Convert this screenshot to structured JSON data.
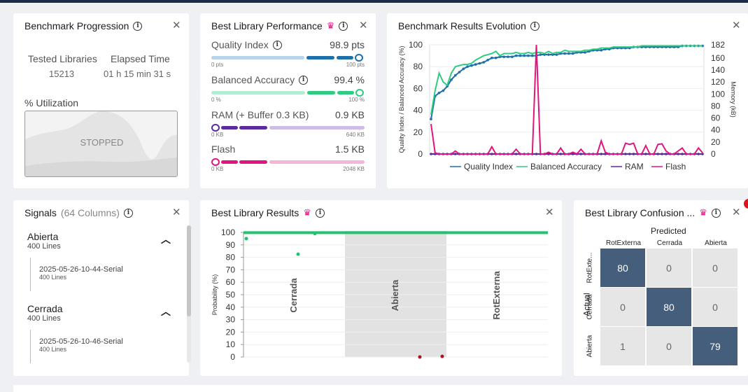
{
  "progression": {
    "title": "Benchmark Progression",
    "tested_label": "Tested Libraries",
    "tested_value": "15213",
    "elapsed_label": "Elapsed Time",
    "elapsed_value": "01 h 15 min 31 s",
    "util_label": "% Utilization",
    "util_status": "STOPPED"
  },
  "performance": {
    "title": "Best Library Performance",
    "metrics": [
      {
        "name": "Quality Index",
        "value": "98.9 pts",
        "min": "0 pts",
        "max": "100 pts",
        "fraction": 0.989,
        "color": "#1f6fa8",
        "light": "#b8d4e8",
        "has_info": true
      },
      {
        "name": "Balanced Accuracy",
        "value": "99.4 %",
        "min": "0 %",
        "max": "100 %",
        "fraction": 0.994,
        "color": "#2ecc80",
        "light": "#b4ecd2",
        "has_info": true
      },
      {
        "name": "RAM (+ Buffer 0.3 KB)",
        "value": "0.9 KB",
        "min": "0 KB",
        "max": "640 KB",
        "fraction": 0.0014,
        "color": "#5b2aa0",
        "light": "#cdbde6",
        "has_info": false
      },
      {
        "name": "Flash",
        "value": "1.5 KB",
        "min": "0 KB",
        "max": "2048 KB",
        "fraction": 0.0007,
        "color": "#e0157f",
        "light": "#f5b5d8",
        "has_info": false
      }
    ]
  },
  "evolution": {
    "title": "Benchmark Results Evolution",
    "y_left_label": "Quality Index / Balanced Accuracy (%)",
    "y_right_label": "Memory (kB)",
    "legend": [
      "Quality Index",
      "Balanced Accuracy",
      "RAM",
      "Flash"
    ],
    "colors": [
      "#1f6fa8",
      "#2ecc80",
      "#5b2aa0",
      "#e0157f"
    ]
  },
  "signals": {
    "title": "Signals",
    "columns": "(64 Columns)",
    "groups": [
      {
        "name": "Abierta",
        "lines": "400 Lines",
        "child": "2025-05-26-10-44-Serial",
        "child_lines": "400 Lines"
      },
      {
        "name": "Cerrada",
        "lines": "400 Lines",
        "child": "2025-05-26-10-46-Serial",
        "child_lines": "400 Lines"
      }
    ]
  },
  "results": {
    "title": "Best Library Results",
    "y_label": "Probability (%)",
    "classes": [
      "Cerrada",
      "Abierta",
      "RotExterna"
    ]
  },
  "confusion": {
    "title": "Best Library Confusion ...",
    "predicted_label": "Predicted",
    "actual_label": "Actual",
    "col_labels": [
      "RotExterna",
      "Cerrada",
      "Abierta"
    ],
    "row_labels": [
      "RotExte...",
      "Cerrada",
      "Abierta"
    ],
    "matrix": [
      [
        "80",
        "0",
        "0"
      ],
      [
        "0",
        "80",
        "0"
      ],
      [
        "1",
        "0",
        "79"
      ]
    ]
  },
  "chart_data": [
    {
      "type": "line",
      "title": "Benchmark Results Evolution",
      "ylabel": "Quality Index / Balanced Accuracy (%)",
      "y2label": "Memory (kB)",
      "ylim": [
        0,
        100
      ],
      "y2lim": [
        0,
        182
      ],
      "yticks": [
        0,
        20,
        40,
        60,
        80,
        100
      ],
      "y2ticks": [
        0,
        20,
        40,
        60,
        80,
        100,
        120,
        140,
        160,
        182
      ],
      "series": [
        {
          "name": "Quality Index",
          "axis": "left",
          "values": [
            32,
            53,
            56,
            58,
            62,
            68,
            72,
            75,
            78,
            80,
            81,
            82,
            83,
            84,
            86,
            88,
            88,
            89,
            89,
            89,
            89,
            90,
            90,
            90,
            90,
            90,
            90,
            91,
            91,
            91,
            91,
            91,
            92,
            92,
            92,
            92,
            93,
            93,
            93,
            94,
            95,
            95,
            95,
            96,
            96,
            97,
            97,
            97,
            97,
            97,
            98,
            98,
            98,
            98,
            98,
            98,
            98,
            98,
            98,
            98,
            98,
            98,
            99,
            99,
            99,
            99,
            99,
            99
          ]
        },
        {
          "name": "Balanced Accuracy",
          "axis": "left",
          "values": [
            36,
            58,
            74,
            66,
            63,
            74,
            80,
            81,
            82,
            82,
            83,
            86,
            88,
            90,
            91,
            92,
            94,
            90,
            92,
            92,
            92,
            93,
            92,
            92,
            93,
            92,
            93,
            93,
            92,
            94,
            92,
            93,
            93,
            95,
            94,
            94,
            94,
            94,
            95,
            95,
            96,
            96,
            97,
            97,
            97,
            98,
            98,
            98,
            98,
            98,
            98,
            98,
            99,
            99,
            99,
            99,
            99,
            99,
            99,
            99,
            99,
            99,
            99,
            99,
            99,
            99,
            99,
            99
          ]
        },
        {
          "name": "RAM",
          "axis": "right",
          "values": [
            0,
            0,
            0,
            0,
            0,
            0,
            0,
            0,
            0,
            0,
            0,
            0,
            0,
            0,
            0,
            0,
            0,
            0,
            0,
            0,
            0,
            0,
            0,
            0,
            0,
            0,
            0,
            0,
            0,
            0,
            0,
            0,
            0,
            0,
            0,
            0,
            0,
            0,
            0,
            0,
            0,
            0,
            0,
            0,
            0,
            0,
            0,
            0,
            0,
            0,
            0,
            0,
            0,
            0,
            0,
            0,
            0,
            0,
            0,
            0,
            0,
            0,
            0,
            0,
            0,
            0,
            0,
            0
          ]
        },
        {
          "name": "Flash",
          "axis": "right",
          "values": [
            50,
            2,
            0,
            0,
            0,
            0,
            5,
            0,
            0,
            0,
            0,
            0,
            0,
            0,
            0,
            12,
            0,
            0,
            0,
            0,
            0,
            8,
            0,
            0,
            0,
            0,
            182,
            0,
            0,
            3,
            0,
            0,
            10,
            0,
            0,
            3,
            0,
            8,
            0,
            0,
            0,
            0,
            22,
            3,
            0,
            0,
            0,
            0,
            18,
            16,
            18,
            0,
            0,
            14,
            0,
            0,
            16,
            17,
            5,
            0,
            0,
            5,
            10,
            0,
            0,
            0,
            10,
            2
          ]
        }
      ],
      "legend": [
        "Quality Index",
        "Balanced Accuracy",
        "RAM",
        "Flash"
      ]
    },
    {
      "type": "scatter",
      "title": "Best Library Results",
      "ylabel": "Probability (%)",
      "ylim": [
        0,
        100
      ],
      "yticks": [
        0,
        10,
        20,
        30,
        40,
        50,
        60,
        70,
        80,
        90,
        100
      ],
      "categories": [
        "Cerrada",
        "Abierta",
        "RotExterna"
      ],
      "series": [
        {
          "class": "Cerrada",
          "correct_min_pct": 96,
          "values_low": [
            95,
            82.5,
            99
          ]
        },
        {
          "class": "Abierta",
          "misclassified": [
            0,
            0.5
          ]
        },
        {
          "class": "RotExterna",
          "values_low": []
        }
      ]
    }
  ]
}
